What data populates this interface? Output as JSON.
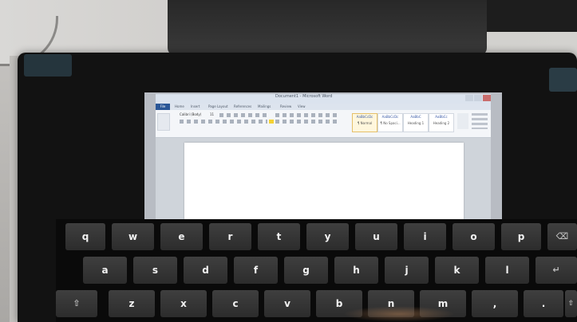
{
  "word_window": {
    "title": "Document1 - Microsoft Word",
    "file_tab": "File",
    "tabs": [
      "Home",
      "Insert",
      "Page Layout",
      "References",
      "Mailings",
      "Review",
      "View"
    ],
    "styles": [
      {
        "label": "AaBbCcDc",
        "name": "¶ Normal",
        "selected": true
      },
      {
        "label": "AaBbCcDc",
        "name": "¶ No Spaci..."
      },
      {
        "label": "AaBbC",
        "name": "Heading 1"
      },
      {
        "label": "AaBbCc",
        "name": "Heading 2"
      }
    ],
    "font_name": "Calibri (Body)",
    "font_size": "11"
  },
  "keyboard": {
    "row1": [
      "q",
      "w",
      "e",
      "r",
      "t",
      "y",
      "u",
      "i",
      "o",
      "p"
    ],
    "row2": [
      "a",
      "s",
      "d",
      "f",
      "g",
      "h",
      "j",
      "k",
      "l"
    ],
    "row3": [
      "z",
      "x",
      "c",
      "v",
      "b",
      "n",
      "m",
      ",",
      "."
    ],
    "backspace_symbol": "⌫",
    "enter_symbol": "↵",
    "shift_symbol": "⇧",
    "shift_right_symbol": "⇧"
  }
}
